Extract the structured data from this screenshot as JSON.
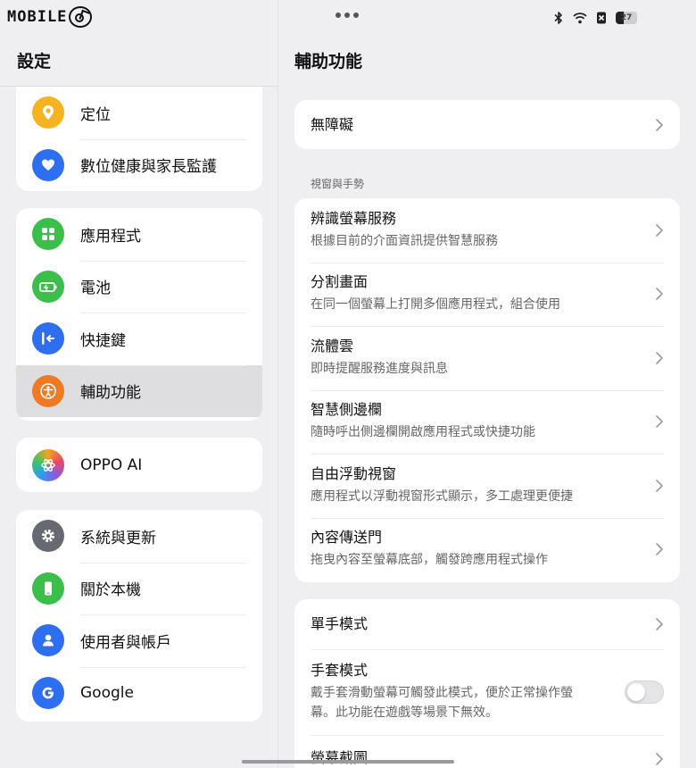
{
  "status": {
    "brand": "MOBILE",
    "battery": "27"
  },
  "left": {
    "title": "設定",
    "groups": [
      {
        "items": [
          {
            "label": "定位",
            "icon": "location-pin-icon",
            "color": "#f5b31f"
          },
          {
            "label": "數位健康與家長監護",
            "icon": "heart-hand-icon",
            "color": "#2d6ff0"
          }
        ]
      },
      {
        "items": [
          {
            "label": "應用程式",
            "icon": "apps-grid-icon",
            "color": "#3bbf4a"
          },
          {
            "label": "電池",
            "icon": "battery-icon",
            "color": "#3bbf4a"
          },
          {
            "label": "快捷鍵",
            "icon": "shortcut-icon",
            "color": "#2d6ff0"
          },
          {
            "label": "輔助功能",
            "icon": "accessibility-icon",
            "color": "#f07a24"
          }
        ]
      },
      {
        "items": [
          {
            "label": "OPPO AI",
            "icon": "oppo-ai-icon",
            "color": "#b65ad6"
          }
        ]
      },
      {
        "items": [
          {
            "label": "系統與更新",
            "icon": "gear-icon",
            "color": "#666a70"
          },
          {
            "label": "關於本機",
            "icon": "phone-icon",
            "color": "#3bbf4a"
          },
          {
            "label": "使用者與帳戶",
            "icon": "user-icon",
            "color": "#2d6ff0"
          },
          {
            "label": "Google",
            "icon": "google-icon",
            "color": "#2d6ff0"
          }
        ]
      }
    ]
  },
  "right": {
    "title": "輔助功能",
    "accessibility": "無障礙",
    "section_label": "視窗與手勢",
    "window_items": [
      {
        "title": "辨識螢幕服務",
        "subtitle": "根據目前的介面資訊提供智慧服務"
      },
      {
        "title": "分割畫面",
        "subtitle": "在同一個螢幕上打開多個應用程式，組合使用"
      },
      {
        "title": "流體雲",
        "subtitle": "即時提醒服務進度與訊息"
      },
      {
        "title": "智慧側邊欄",
        "subtitle": "隨時呼出側邊欄開啟應用程式或快捷功能"
      },
      {
        "title": "自由浮動視窗",
        "subtitle": "應用程式以浮動視窗形式顯示，多工處理更便捷"
      },
      {
        "title": "內容傳送門",
        "subtitle": "拖曳內容至螢幕底部，觸發跨應用程式操作"
      }
    ],
    "one_hand": "單手模式",
    "glove_title": "手套模式",
    "glove_subtitle": "戴手套滑動螢幕可觸發此模式，便於正常操作螢幕。此功能在遊戲等場景下無效。",
    "glove_enabled": false,
    "screenshot": "螢幕截圖"
  }
}
